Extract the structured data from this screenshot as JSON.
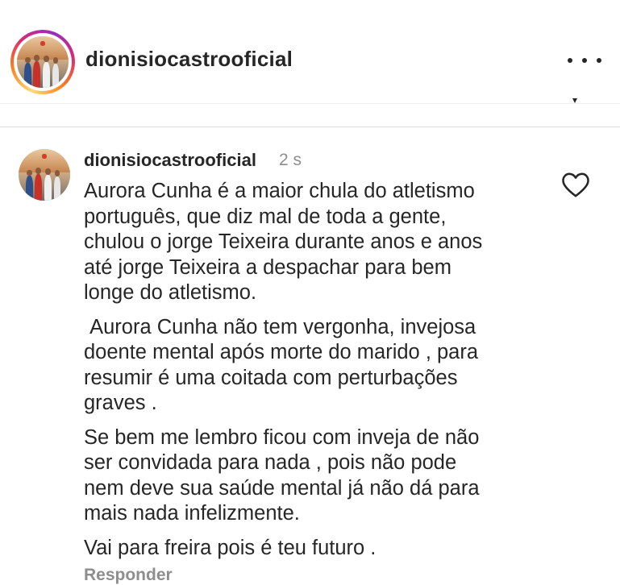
{
  "post": {
    "username": "dionisiocastrooficial"
  },
  "comment": {
    "username": "dionisiocastrooficial",
    "time": "2 s",
    "paragraphs": [
      "Aurora Cunha é a maior chula do atletismo\nportuguês, que diz mal de toda a gente,\nchulou o jorge Teixeira durante anos e anos\naté jorge Teixeira a despachar para bem\nlonge do atletismo.",
      " Aurora Cunha não tem vergonha, invejosa\ndoente mental após morte do marido , para\nresumir é uma coitada com perturbações\ngraves .",
      "Se bem me lembro ficou com inveja de não\nser convidada para nada , pois não pode\nnem deve sua saúde mental já não dá para\nmais nada infelizmente.",
      "Vai para freira pois é teu futuro ."
    ],
    "reply_label": "Responder"
  },
  "icons": {
    "more": "more-horizontal-icon",
    "like": "heart-outline-icon",
    "avatar": "profile-avatar"
  },
  "colors": {
    "text": "#262626",
    "secondary": "#8e8e8e",
    "story_ring": [
      "#feda75",
      "#fa7e1e",
      "#d62976",
      "#962fbf"
    ]
  }
}
